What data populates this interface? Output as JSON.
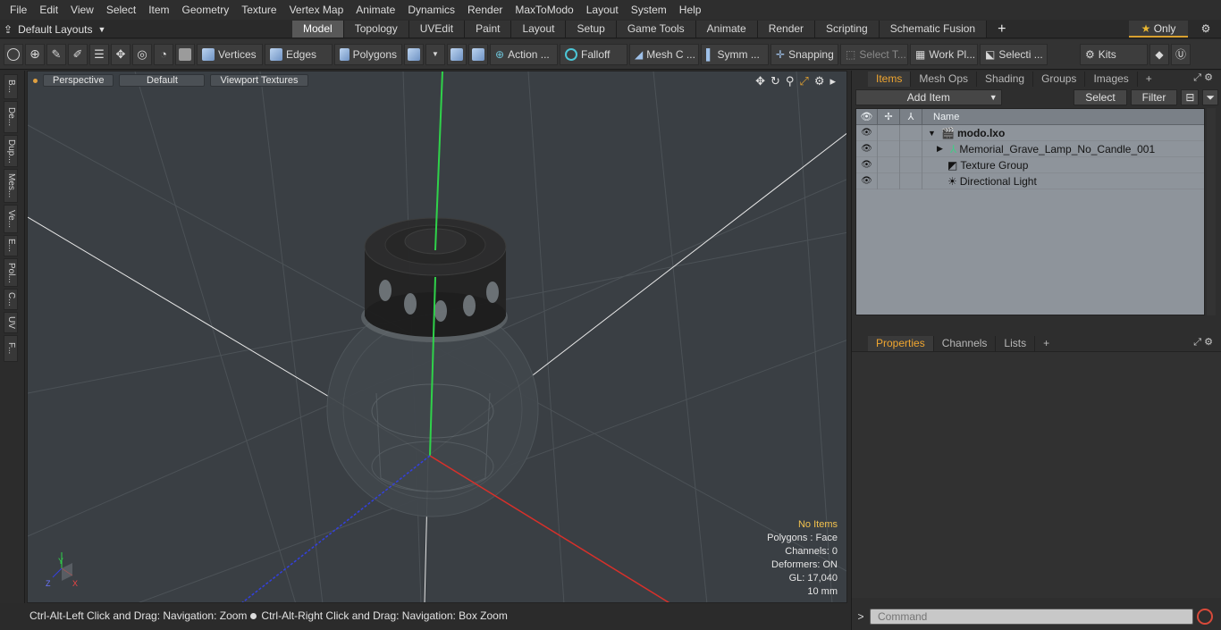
{
  "menubar": {
    "items": [
      "File",
      "Edit",
      "View",
      "Select",
      "Item",
      "Geometry",
      "Texture",
      "Vertex Map",
      "Animate",
      "Dynamics",
      "Render",
      "MaxToModo",
      "Layout",
      "System",
      "Help"
    ]
  },
  "layoutbar": {
    "layouts_label": "Default Layouts",
    "tabs": [
      "Model",
      "Topology",
      "UVEdit",
      "Paint",
      "Layout",
      "Setup",
      "Game Tools",
      "Animate",
      "Render",
      "Scripting",
      "Schematic Fusion"
    ],
    "active_tab": "Model",
    "only_label": "Only"
  },
  "toolbar": {
    "vertices": "Vertices",
    "edges": "Edges",
    "polygons": "Polygons",
    "action": "Action ...",
    "falloff": "Falloff",
    "meshc": "Mesh C ...",
    "symm": "Symm ...",
    "snapping": "Snapping",
    "selectt": "Select T...",
    "workpl": "Work Pl...",
    "selecti": "Selecti ...",
    "kits": "Kits"
  },
  "leftstrip": {
    "items": [
      "B...",
      "De...",
      "Dup...",
      "Mes...",
      "Ve...",
      "E...",
      "Pol...",
      "C...",
      "UV",
      "F..."
    ]
  },
  "viewport": {
    "view_label": "Perspective",
    "shading_label": "Default",
    "textures_label": "Viewport Textures",
    "stats": {
      "no_items": "No Items",
      "polygons": "Polygons : Face",
      "channels": "Channels: 0",
      "deformers": "Deformers: ON",
      "gl": "GL: 17,040",
      "scale": "10 mm"
    },
    "axis_labels": {
      "y": "Y",
      "z": "Z",
      "x": "X"
    }
  },
  "statusbar": {
    "left": "Ctrl-Alt-Left Click and Drag: Navigation: Zoom",
    "right": "Ctrl-Alt-Right Click and Drag: Navigation: Box Zoom"
  },
  "items_panel": {
    "tabs": [
      "Items",
      "Mesh Ops",
      "Shading",
      "Groups",
      "Images"
    ],
    "active_tab": "Items",
    "add_item": "Add Item",
    "select": "Select",
    "filter": "Filter",
    "column_name": "Name",
    "rows": [
      {
        "name": "modo.lxo",
        "bold": true,
        "depth": 0,
        "expander": "▼"
      },
      {
        "name": "Memorial_Grave_Lamp_No_Candle_001",
        "bold": false,
        "depth": 1,
        "expander": "▶"
      },
      {
        "name": "Texture Group",
        "bold": false,
        "depth": 1,
        "expander": ""
      },
      {
        "name": "Directional Light",
        "bold": false,
        "depth": 1,
        "expander": ""
      }
    ]
  },
  "properties_panel": {
    "tabs": [
      "Properties",
      "Channels",
      "Lists"
    ],
    "active_tab": "Properties"
  },
  "command": {
    "placeholder": "Command"
  }
}
